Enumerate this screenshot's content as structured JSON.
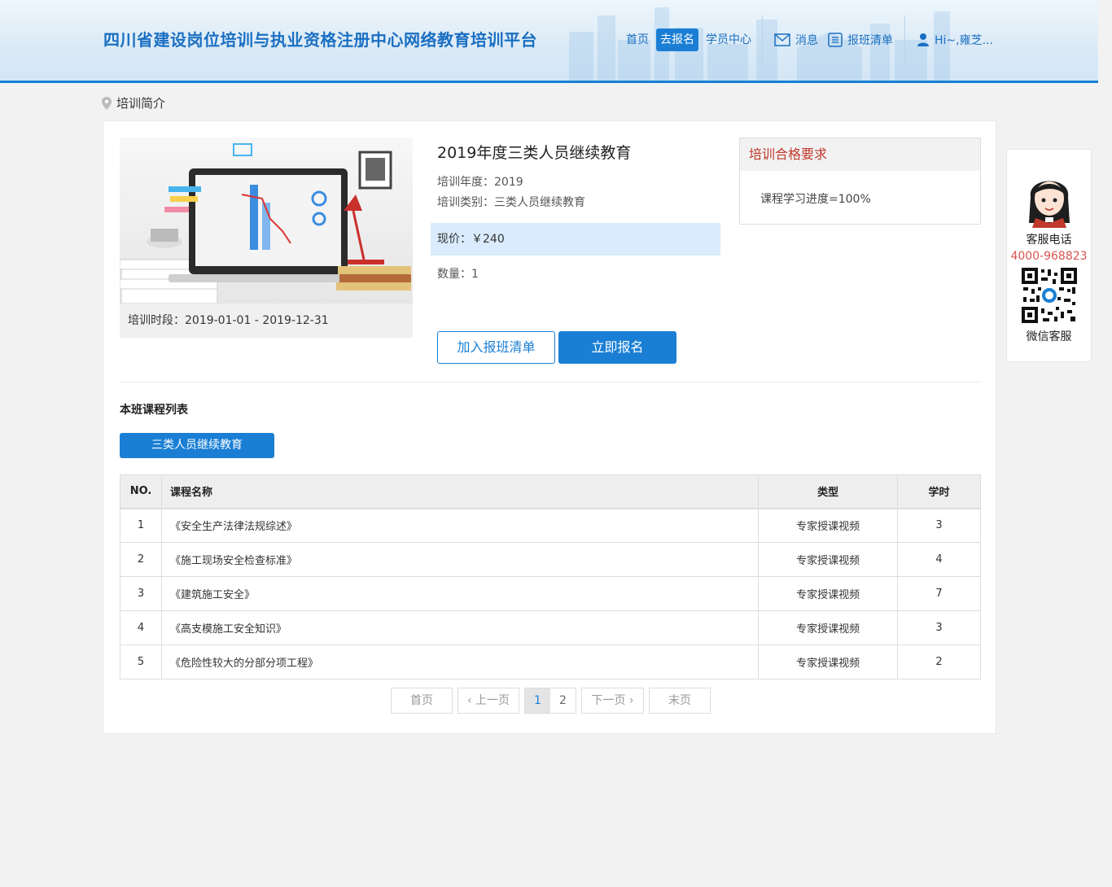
{
  "header": {
    "site_title": "四川省建设岗位培训与执业资格注册中心网络教育培训平台",
    "nav": {
      "home": "首页",
      "enroll": "去报名",
      "student_center": "学员中心",
      "messages": "消息",
      "cart": "报班清单",
      "user": "Hi~,雍芝..."
    }
  },
  "breadcrumb": {
    "label": "培训简介"
  },
  "course": {
    "period": "培训时段：2019-01-01 - 2019-12-31",
    "title": "2019年度三类人员继续教育",
    "year": "培训年度：2019",
    "category": "培训类别：三类人员继续教育",
    "price": "现价：￥240",
    "quantity": "数量：1",
    "add_to_cart": "加入报班清单",
    "enroll_now": "立即报名"
  },
  "requirements": {
    "heading": "培训合格要求",
    "text": "课程学习进度=100%"
  },
  "course_list": {
    "title": "本班课程列表",
    "tag": "三类人员继续教育",
    "headers": {
      "no": "NO.",
      "name": "课程名称",
      "type": "类型",
      "hours": "学时"
    },
    "rows": [
      {
        "no": "1",
        "name": "《安全生产法律法规综述》",
        "type": "专家授课视频",
        "hours": "3"
      },
      {
        "no": "2",
        "name": "《施工现场安全检查标准》",
        "type": "专家授课视频",
        "hours": "4"
      },
      {
        "no": "3",
        "name": "《建筑施工安全》",
        "type": "专家授课视频",
        "hours": "7"
      },
      {
        "no": "4",
        "name": "《高支模施工安全知识》",
        "type": "专家授课视频",
        "hours": "3"
      },
      {
        "no": "5",
        "name": "《危险性较大的分部分项工程》",
        "type": "专家授课视频",
        "hours": "2"
      }
    ]
  },
  "pager": {
    "first": "首页",
    "prev": "‹ 上一页",
    "page1": "1",
    "page2": "2",
    "next": "下一页 ›",
    "last": "末页"
  },
  "service": {
    "phone_label": "客服电话",
    "phone": "4000-968823",
    "wechat_label": "微信客服"
  },
  "colors": {
    "accent": "#1a7fd4",
    "price_bg": "#d9ebfc",
    "requirement_title": "#c0392b"
  }
}
